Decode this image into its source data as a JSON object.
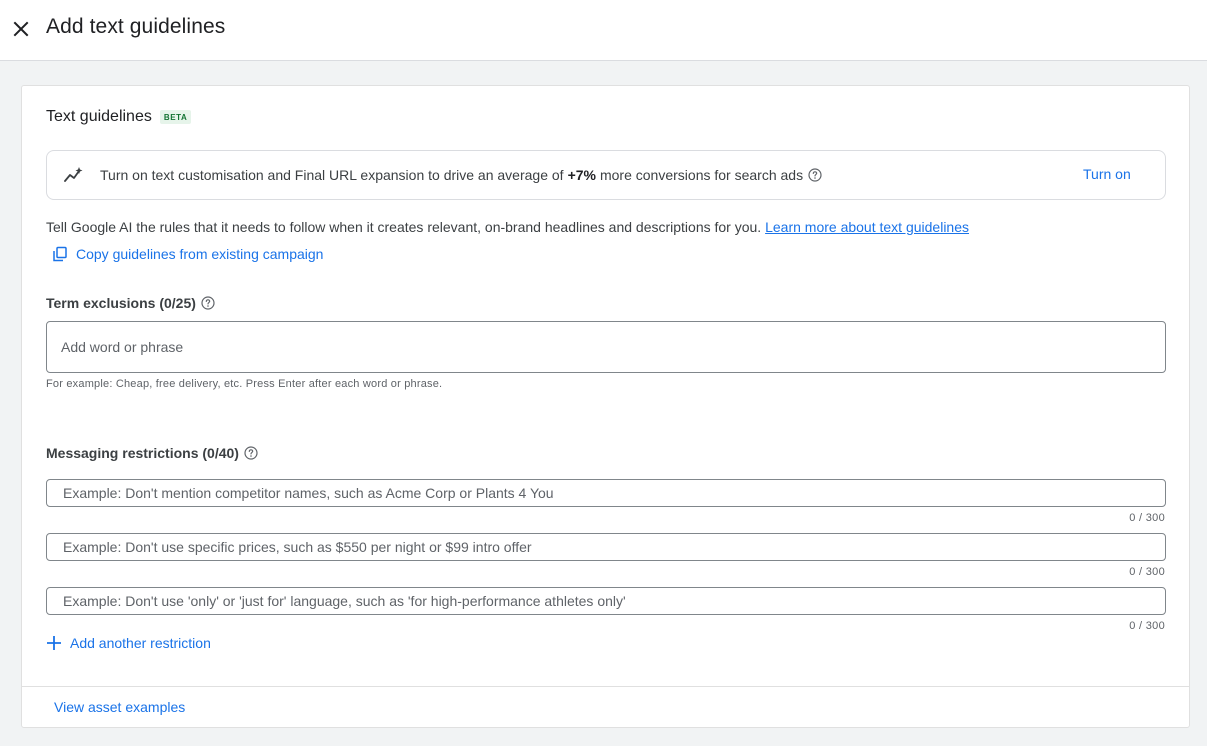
{
  "header": {
    "title": "Add text guidelines",
    "close_icon": "close-icon"
  },
  "card": {
    "title": "Text guidelines",
    "badge": "BETA",
    "promo": {
      "icon": "trending-sparkle-icon",
      "text_before": "Turn on text customisation and Final URL expansion to drive an average of",
      "highlight": "+7%",
      "text_after": "more conversions for search ads",
      "action_label": "Turn on"
    },
    "description": "Tell Google AI the rules that it needs to follow when it creates relevant, on-brand headlines and descriptions for you.",
    "learn_more_label": "Learn more about text guidelines",
    "copy_label": "Copy guidelines from existing campaign",
    "term_exclusions": {
      "label": "Term exclusions (0/25)",
      "placeholder": "Add word or phrase",
      "value": "",
      "hint": "For example: Cheap, free delivery, etc. Press Enter after each word or phrase."
    },
    "messaging_restrictions": {
      "label": "Messaging restrictions (0/40)",
      "items": [
        {
          "placeholder": "Example: Don't mention competitor names, such as Acme Corp or Plants 4 You",
          "value": "",
          "counter": "0 / 300"
        },
        {
          "placeholder": "Example: Don't use specific prices, such as $550 per night or $99 intro offer",
          "value": "",
          "counter": "0 / 300"
        },
        {
          "placeholder": "Example: Don't use 'only' or 'just for' language, such as 'for high-performance athletes only'",
          "value": "",
          "counter": "0 / 300"
        }
      ],
      "add_label": "Add another restriction"
    },
    "footer_link": "View asset examples"
  },
  "colors": {
    "accent": "#1a73e8",
    "beta_bg": "#e6f4ea",
    "beta_text": "#137333",
    "page_bg": "#f1f3f4"
  }
}
